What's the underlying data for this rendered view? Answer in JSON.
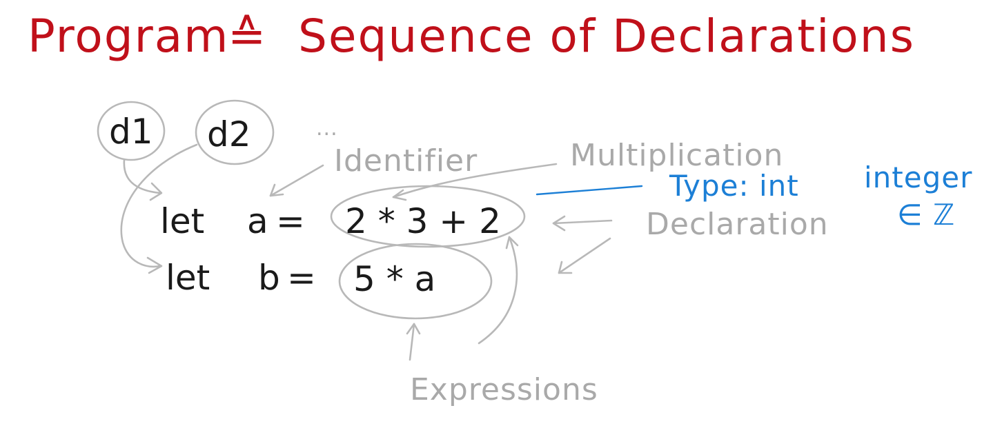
{
  "title": {
    "left": "Program",
    "symbol": "≙",
    "right": "Sequence of Declarations"
  },
  "declaration_labels": {
    "d1": "d1",
    "d2": "d2",
    "ellipsis": "..."
  },
  "code": {
    "line1": {
      "keyword": "let",
      "name": "a",
      "equals": "=",
      "expr": "2 * 3 + 2"
    },
    "line2": {
      "keyword": "let",
      "name": "b",
      "equals": "=",
      "expr": "5 * a"
    }
  },
  "annotations": {
    "identifier": "Identifier",
    "multiplication": "Multiplication",
    "declaration": "Declaration",
    "expressions": "Expressions",
    "type": "Type: int",
    "integer": "integer",
    "element_of_z": "∈ ℤ"
  },
  "colors": {
    "title": "#c0101a",
    "code": "#1a1a1a",
    "annotation": "#a9a9a9",
    "type_note": "#1c7fd6"
  }
}
